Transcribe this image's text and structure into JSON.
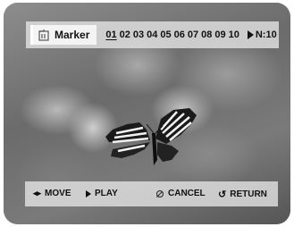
{
  "marker": {
    "title": "Marker",
    "icon": "marker-icon",
    "chapters": [
      "01",
      "02",
      "03",
      "04",
      "05",
      "06",
      "07",
      "08",
      "09",
      "10"
    ],
    "selected_chapter": "01",
    "count_label": "N:10"
  },
  "controls": {
    "move": "MOVE",
    "play": "PLAY",
    "cancel": "CANCEL",
    "return": "RETURN"
  },
  "icons": {
    "move": "left-right-arrow-icon",
    "play": "play-icon",
    "cancel": "cancel-icon",
    "return": "return-arrow-icon"
  }
}
